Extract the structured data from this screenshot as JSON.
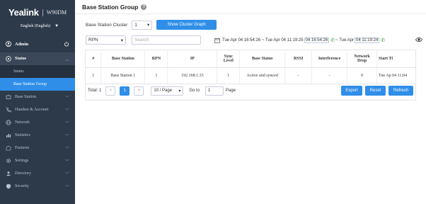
{
  "app": {
    "brand": "Yealink",
    "model": "W90DM"
  },
  "language": {
    "value": "English (English)"
  },
  "user": {
    "name": "Admin"
  },
  "sidebar": {
    "items": [
      {
        "label": "Status",
        "open": true
      },
      {
        "label": "Base Station"
      },
      {
        "label": "Handset & Account"
      },
      {
        "label": "Network"
      },
      {
        "label": "Statistics"
      },
      {
        "label": "Features"
      },
      {
        "label": "Settings"
      },
      {
        "label": "Directory"
      },
      {
        "label": "Security"
      }
    ],
    "subitems": [
      {
        "label": "Status"
      },
      {
        "label": "Base Station Group",
        "active": true
      }
    ]
  },
  "page": {
    "title": "Base Station Group",
    "help": "?"
  },
  "cluster": {
    "label": "Base Station Cluster",
    "value": "1",
    "button": "Show Cluster Graph"
  },
  "filter": {
    "rpn_value": "RPN",
    "search_placeholder": "Search",
    "date_text": "Tue Apr 04 16:54:26 ~ Tue Apr 04 11:19:25",
    "date_box1": "04 16:54:26",
    "date_mid": "~ Tue Apr",
    "date_box2": "04 11:19:24"
  },
  "table": {
    "headers": [
      "#",
      "Base Station",
      "RPN",
      "IP",
      "Sync Level",
      "Base Status",
      "RSSI",
      "Interference",
      "Network Drop",
      "Start Ti"
    ],
    "rows": [
      [
        "1",
        "Base Station 1",
        "1",
        "192.168.1.33",
        "1",
        "Active and synced",
        "-",
        "-",
        "0",
        "Tue Ap 04 11:04"
      ]
    ]
  },
  "pager": {
    "total": "Total: 1",
    "prev": "<",
    "current": "1",
    "next": ">",
    "per_page": "10 / Page",
    "goto_label": "Go to",
    "goto_value": "1",
    "page_label": "Page"
  },
  "actions": {
    "export": "Export",
    "reset": "Reset",
    "refresh": "Refresh"
  },
  "colors": {
    "sidebar": "#2d3a4a",
    "accent": "#2f8ee8"
  }
}
